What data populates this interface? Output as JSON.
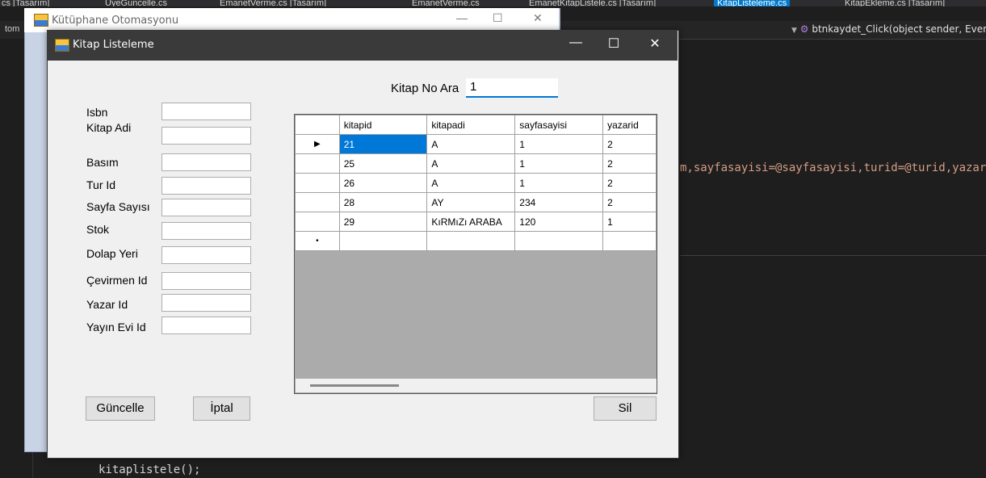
{
  "ide": {
    "tabs": [
      {
        "label": "cs [Tasarım]",
        "active": false
      },
      {
        "label": "UyeGuncelle.cs",
        "active": false
      },
      {
        "label": "EmanetVerme.cs [Tasarım]",
        "active": false
      },
      {
        "label": "EmanetVerme.cs",
        "active": false
      },
      {
        "label": "EmanetKitapListele.cs [Tasarım]",
        "active": false
      },
      {
        "label": "KitapListeleme.cs",
        "active": true
      },
      {
        "label": "KitapEkleme.cs [Tasarım]",
        "active": false
      }
    ],
    "left_nav": "tom",
    "method_dropdown": "btnkaydet_Click(object sender, EventArgs e)",
    "code_line_sql": "m,sayfasayisi=@sayfasayisi,turid=@turid,yazari",
    "code_line_call": "kitaplistele();"
  },
  "back_window": {
    "title": "Kütüphane Otomasyonu"
  },
  "form": {
    "title": "Kitap Listeleme",
    "search_label": "Kitap No Ara",
    "search_value": "1",
    "fields": [
      {
        "label": "Isbn",
        "value": ""
      },
      {
        "label": "Kitap Adi",
        "value": ""
      },
      {
        "label": "Basım",
        "value": ""
      },
      {
        "label": "Tur Id",
        "value": ""
      },
      {
        "label": "Sayfa Sayısı",
        "value": ""
      },
      {
        "label": "Stok",
        "value": ""
      },
      {
        "label": "Dolap Yeri",
        "value": ""
      },
      {
        "label": "Çevirmen Id",
        "value": ""
      },
      {
        "label": "Yazar Id",
        "value": ""
      },
      {
        "label": "Yayın Evi Id",
        "value": ""
      }
    ],
    "buttons": {
      "update": "Güncelle",
      "cancel": "İptal",
      "delete": "Sil"
    },
    "grid": {
      "columns": [
        "kitapid",
        "kitapadi",
        "sayfasayisi",
        "yazarid"
      ],
      "rows": [
        [
          "21",
          "A",
          "1",
          "2"
        ],
        [
          "25",
          "A",
          "1",
          "2"
        ],
        [
          "26",
          "A",
          "1",
          "2"
        ],
        [
          "28",
          "AY",
          "234",
          "2"
        ],
        [
          "29",
          "KıRMıZı ARABA",
          "120",
          "1"
        ]
      ],
      "current_row_marker": "▶",
      "new_row_marker": "•"
    }
  }
}
